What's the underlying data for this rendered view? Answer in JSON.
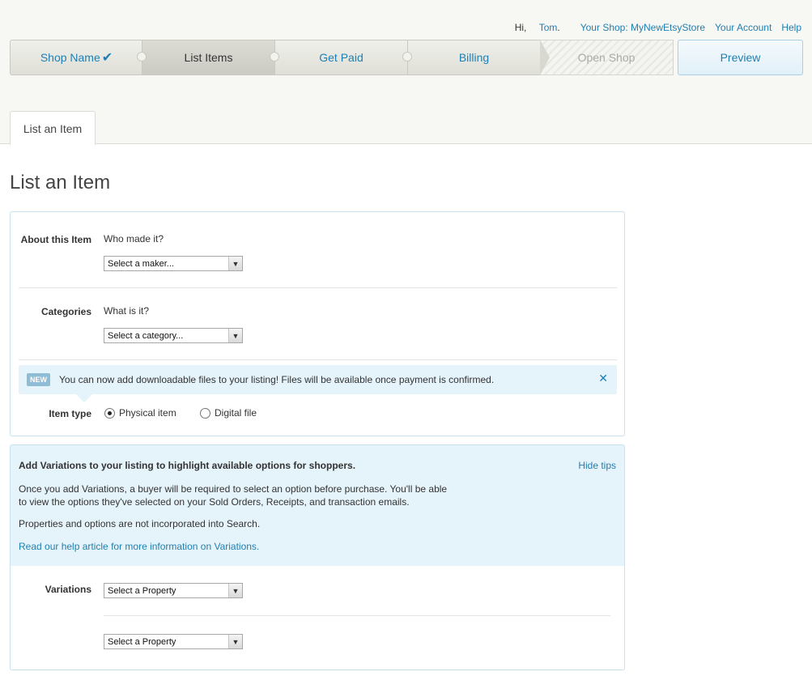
{
  "header": {
    "greeting_prefix": "Hi,",
    "user_name": "Tom",
    "greeting_suffix": ".",
    "shop_link": "Your Shop: MyNewEtsyStore",
    "account_link": "Your Account",
    "help_link": "Help"
  },
  "steps": [
    {
      "label": "Shop Name",
      "state": "completed",
      "icon": "checkmark-icon"
    },
    {
      "label": "List Items",
      "state": "current"
    },
    {
      "label": "Get Paid",
      "state": "upcoming"
    },
    {
      "label": "Billing",
      "state": "upcoming"
    },
    {
      "label": "Open Shop",
      "state": "disabled"
    }
  ],
  "preview_button": "Preview",
  "tab": {
    "label": "List an Item"
  },
  "page_title": "List an Item",
  "about": {
    "label": "About this Item",
    "question": "Who made it?",
    "select_value": "Select a maker..."
  },
  "categories": {
    "label": "Categories",
    "question": "What is it?",
    "select_value": "Select a category..."
  },
  "notice": {
    "badge": "NEW",
    "text": "You can now add downloadable files to your listing! Files will be available once payment is confirmed.",
    "close_icon": "close-icon"
  },
  "item_type": {
    "label": "Item type",
    "options": [
      {
        "label": "Physical item",
        "selected": true
      },
      {
        "label": "Digital file",
        "selected": false
      }
    ]
  },
  "variations_tips": {
    "title": "Add Variations to your listing to highlight available options for shoppers.",
    "hide_label": "Hide tips",
    "paragraph1": "Once you add Variations, a buyer will be required to select an option before purchase. You'll be able to view the options they've selected on your Sold Orders, Receipts, and transaction emails.",
    "paragraph2": "Properties and options are not incorporated into Search.",
    "help_link": "Read our help article for more information on Variations."
  },
  "variations": {
    "label": "Variations",
    "select1": "Select a Property",
    "select2": "Select a Property"
  },
  "colors": {
    "link": "#1f7fb2",
    "tip_background": "#e5f3fa",
    "panel_border": "#c7e1ef"
  }
}
